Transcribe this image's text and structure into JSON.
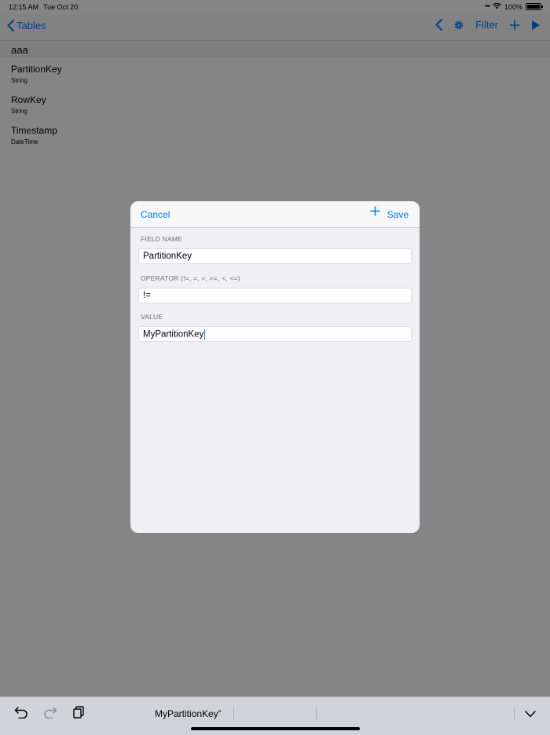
{
  "status_bar": {
    "time": "12:15 AM",
    "date": "Tue Oct 20",
    "battery": "100%",
    "battery_level": 1.0
  },
  "nav": {
    "back_label": "Tables",
    "filter_label": "Filter",
    "icons": [
      "chevron-left-icon",
      "gear-icon",
      "plus-icon",
      "play-icon"
    ]
  },
  "table": {
    "name": "aaa",
    "columns": [
      {
        "name": "PartitionKey",
        "type": "String"
      },
      {
        "name": "RowKey",
        "type": "String"
      },
      {
        "name": "Timestamp",
        "type": "DateTime"
      }
    ]
  },
  "modal": {
    "cancel_label": "Cancel",
    "save_label": "Save",
    "field_name_label": "FIELD NAME",
    "field_name_value": "PartitionKey",
    "operator_label": "OPERATOR (!=, =, >, >=, <, <=)",
    "operator_value": "!=",
    "value_label": "VALUE",
    "value_value": "MyPartitionKey"
  },
  "keyboard_bar": {
    "suggestion": "MyPartitionKey”",
    "icons": [
      "undo-icon",
      "redo-icon",
      "paste-icon",
      "dismiss-keyboard-icon"
    ]
  },
  "colors": {
    "accent": "#007aff",
    "overlay": "rgba(0,0,0,0.48)",
    "modal_background": "#efeff4"
  }
}
